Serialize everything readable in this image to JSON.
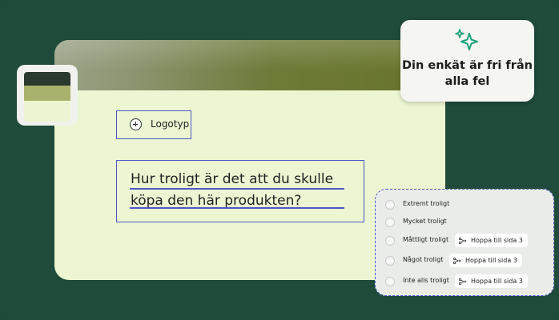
{
  "logo": {
    "label": "Logotyp"
  },
  "question": {
    "text": "Hur troligt är det att du skulle köpa den här produkten?"
  },
  "notification": {
    "message": "Din enkät är fri från alla fel"
  },
  "options": [
    {
      "label": "Extremt troligt"
    },
    {
      "label": "Mycket troligt"
    },
    {
      "label": "Måttligt troligt",
      "skip": "Hoppa till sida 3"
    },
    {
      "label": "Något troligt",
      "skip": "Hoppa till sida 3"
    },
    {
      "label": "Inte alls troligt",
      "skip": "Hoppa till sida 3"
    }
  ],
  "colors": {
    "background": "#1f4b3b",
    "card": "#ecf6d2",
    "accent": "#4d57c8",
    "sparkle": "#1fa37c"
  },
  "icons": {
    "logo": "plus-circle-icon",
    "notification": "sparkle-icon",
    "skip": "branch-icon"
  }
}
